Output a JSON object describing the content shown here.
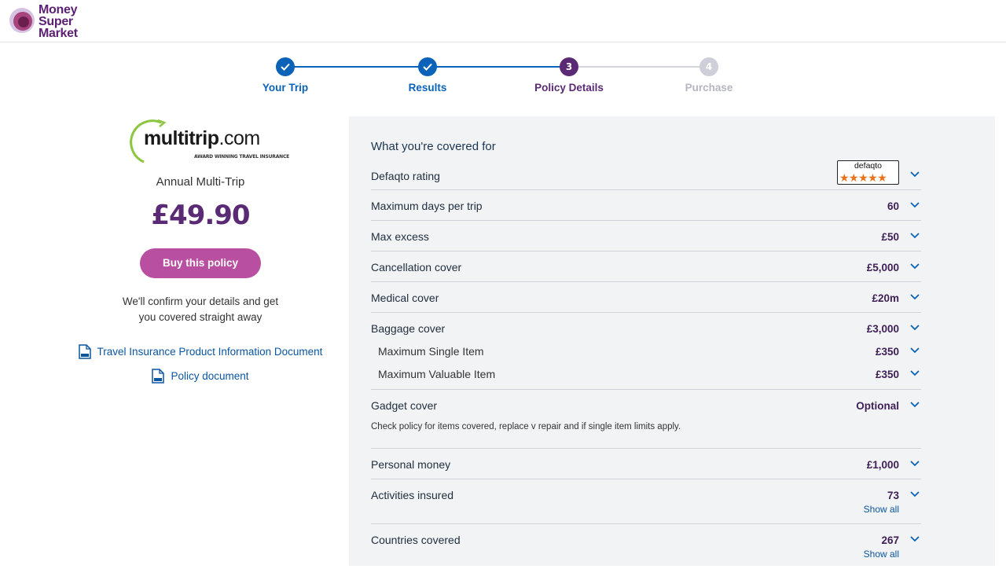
{
  "logo": {
    "line1": "Money",
    "line2": "Super",
    "line3": "Market"
  },
  "steps": [
    {
      "label": "Your Trip",
      "state": "done"
    },
    {
      "label": "Results",
      "state": "done"
    },
    {
      "label": "Policy Details",
      "state": "current",
      "number": "3"
    },
    {
      "label": "Purchase",
      "state": "todo",
      "number": "4"
    }
  ],
  "provider": {
    "name_bold": "multitrip",
    "name_rest": ".com",
    "tagline": "AWARD WINNING TRAVEL INSURANCE",
    "product": "Annual Multi-Trip",
    "price": "£49.90",
    "buy_label": "Buy this policy",
    "confirm_line1": "We'll confirm your details and get",
    "confirm_line2": "you covered straight away",
    "doc1": "Travel Insurance Product Information Document",
    "doc2": "Policy document"
  },
  "cover": {
    "title": "What you're covered for",
    "defaqto_label": "Defaqto rating",
    "defaqto_badge": "defaqto",
    "defaqto_stars": 5,
    "max_days": {
      "label": "Maximum days per trip",
      "value": "60"
    },
    "max_excess": {
      "label": "Max excess",
      "value": "£50"
    },
    "cancellation": {
      "label": "Cancellation cover",
      "value": "£5,000"
    },
    "medical": {
      "label": "Medical cover",
      "value": "£20m"
    },
    "baggage": {
      "label": "Baggage cover",
      "value": "£3,000"
    },
    "single_item": {
      "label": "Maximum Single Item",
      "value": "£350"
    },
    "valuable_item": {
      "label": "Maximum Valuable Item",
      "value": "£350"
    },
    "gadget": {
      "label": "Gadget cover",
      "value": "Optional",
      "note": "Check policy for items covered, replace v repair and if single item limits apply."
    },
    "personal_money": {
      "label": "Personal money",
      "value": "£1,000"
    },
    "activities": {
      "label": "Activities insured",
      "value": "73",
      "link": "Show all"
    },
    "countries": {
      "label": "Countries covered",
      "value": "267",
      "link": "Show all"
    }
  },
  "colors": {
    "accent_blue": "#0a63b8",
    "brand_purple": "#5b2a74",
    "buy_button": "#b94fa0",
    "star_orange": "#e8731a"
  }
}
